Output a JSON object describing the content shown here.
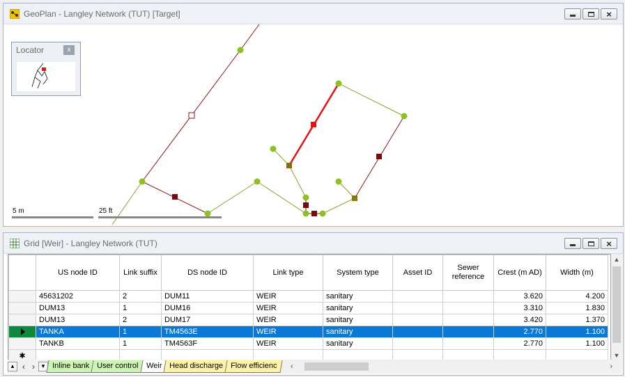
{
  "geoplan": {
    "title": "GeoPlan - Langley Network (TUT) [Target]",
    "locator_title": "Locator",
    "locator_close": "x",
    "scale_m": "5 m",
    "scale_ft": "25 ft"
  },
  "grid": {
    "title": "Grid [Weir] - Langley Network (TUT)",
    "columns": [
      "US node ID",
      "Link suffix",
      "DS node ID",
      "Link type",
      "System type",
      "Asset ID",
      "Sewer reference",
      "Crest (m AD)",
      "Width (m)"
    ],
    "rows": [
      [
        "45631202",
        "2",
        "DUM11",
        "WEIR",
        "sanitary",
        "",
        "",
        "3.620",
        "4.200"
      ],
      [
        "DUM13",
        "1",
        "DUM16",
        "WEIR",
        "sanitary",
        "",
        "",
        "3.310",
        "1.830"
      ],
      [
        "DUM13",
        "2",
        "DUM17",
        "WEIR",
        "sanitary",
        "",
        "",
        "3.420",
        "1.370"
      ],
      [
        "TANKA",
        "1",
        "TM4563E",
        "WEIR",
        "sanitary",
        "",
        "",
        "2.770",
        "1.100"
      ],
      [
        "TANKB",
        "1",
        "TM4563F",
        "WEIR",
        "sanitary",
        "",
        "",
        "2.770",
        "1.100"
      ]
    ],
    "selected_row": 3,
    "new_row_marker": "✱",
    "tabs": [
      {
        "label": "Inline bank",
        "color": "green"
      },
      {
        "label": "User control",
        "color": "green"
      },
      {
        "label": "Weir",
        "color": "white",
        "active": true
      },
      {
        "label": "Head discharge",
        "color": "yellow"
      },
      {
        "label": "Flow efficienc",
        "color": "yellow"
      }
    ]
  },
  "colors": {
    "node_green": "#8cc11f",
    "link_dark_red": "#8b1a1a",
    "link_olive": "#8f9f2a",
    "selected_red": "#e81010",
    "selection_blue": "#0a78d7"
  }
}
